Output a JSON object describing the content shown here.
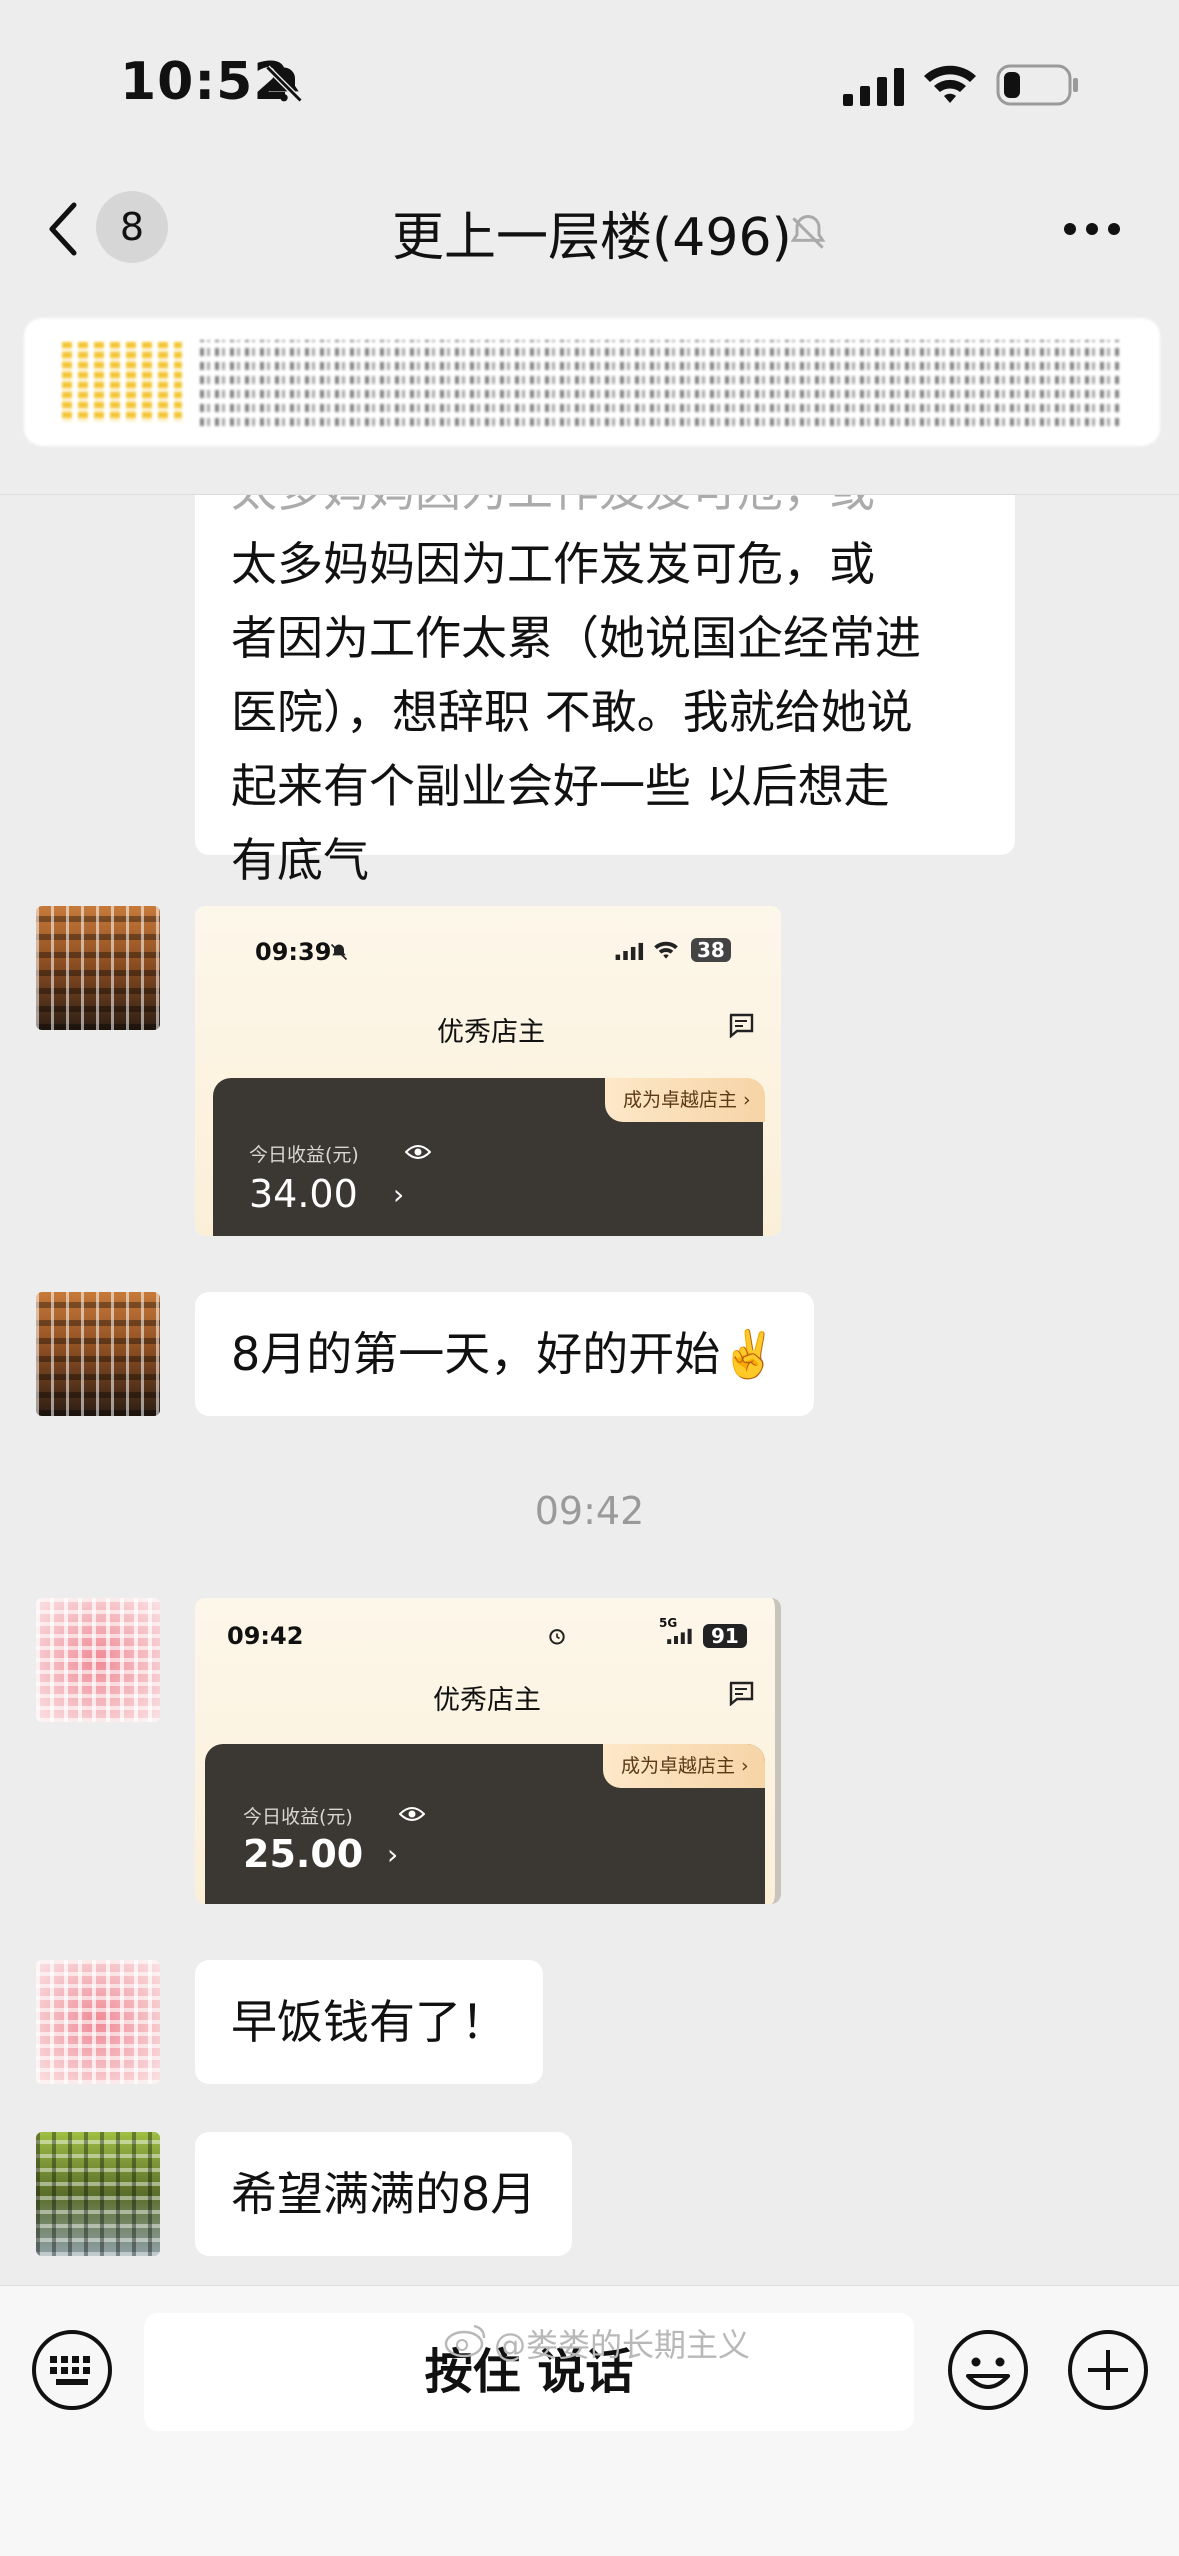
{
  "status_bar": {
    "time": "10:52"
  },
  "nav": {
    "badge": "8",
    "title": "更上一层楼(496)"
  },
  "messages": {
    "long_text_lines": [
      "太多妈妈因为工作岌岌可危，或",
      "者因为工作太累（她说国企经常进",
      "医院），想辞职 不敢。我就给她说",
      "起来有个副业会好一些 以后想走",
      "有底气"
    ],
    "shot1": {
      "time": "09:39",
      "battery": "38",
      "title": "优秀店主",
      "promo": "成为卓越店主",
      "label": "今日收益(元)",
      "value": "34.00"
    },
    "text1": "8月的第一天，好的开始✌️",
    "separator": "09:42",
    "shot2": {
      "time": "09:42",
      "battery": "91",
      "network": "5G",
      "title": "优秀店主",
      "promo": "成为卓越店主",
      "label": "今日收益(元)",
      "value": "25.00"
    },
    "text2": "早饭钱有了！",
    "text3": "希望满满的8月"
  },
  "input_bar": {
    "talk_label": "按住 说话"
  },
  "watermark": "@娄娄的长期主义"
}
